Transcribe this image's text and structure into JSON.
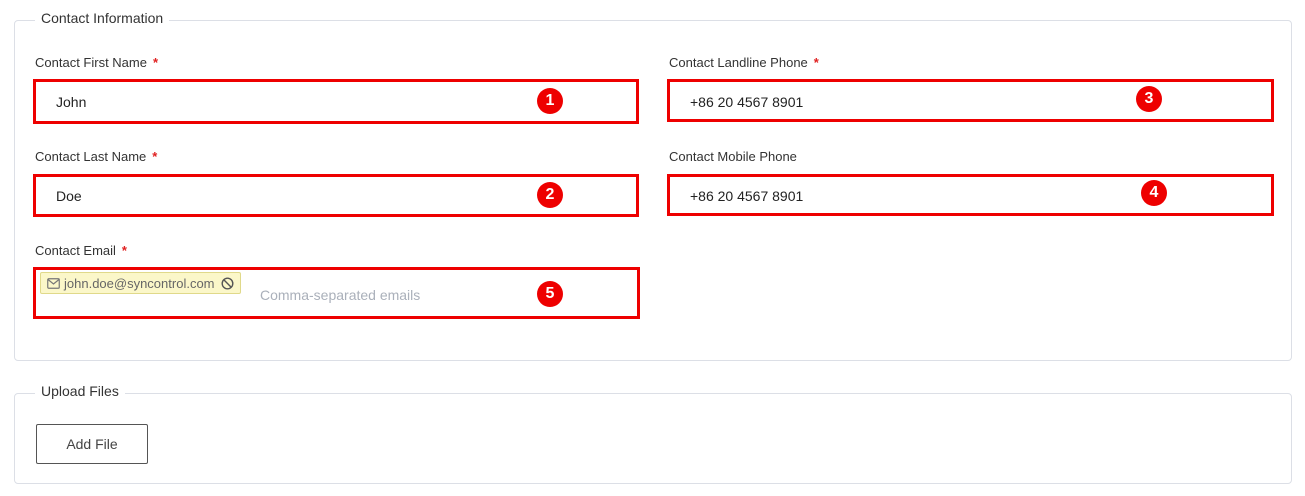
{
  "contact_section": {
    "legend": "Contact Information",
    "required_mark": "*",
    "first_name": {
      "label": "Contact First Name",
      "value": "John",
      "badge": "1"
    },
    "last_name": {
      "label": "Contact Last Name",
      "value": "Doe",
      "badge": "2"
    },
    "landline": {
      "label": "Contact Landline Phone",
      "value": "+86 20 4567 8901",
      "badge": "3"
    },
    "mobile": {
      "label": "Contact Mobile Phone",
      "value": "+86 20 4567 8901",
      "badge": "4"
    },
    "email": {
      "label": "Contact Email",
      "chip_value": "john.doe@syncontrol.com",
      "placeholder": "Comma-separated emails",
      "badge": "5",
      "chip_icon": "mail-icon",
      "remove_icon": "block-icon"
    }
  },
  "upload_section": {
    "legend": "Upload Files",
    "add_button": "Add File"
  },
  "colors": {
    "annotation_red": "#ee0000",
    "chip_bg": "#fbf7c9",
    "border": "#dcdfe6"
  }
}
